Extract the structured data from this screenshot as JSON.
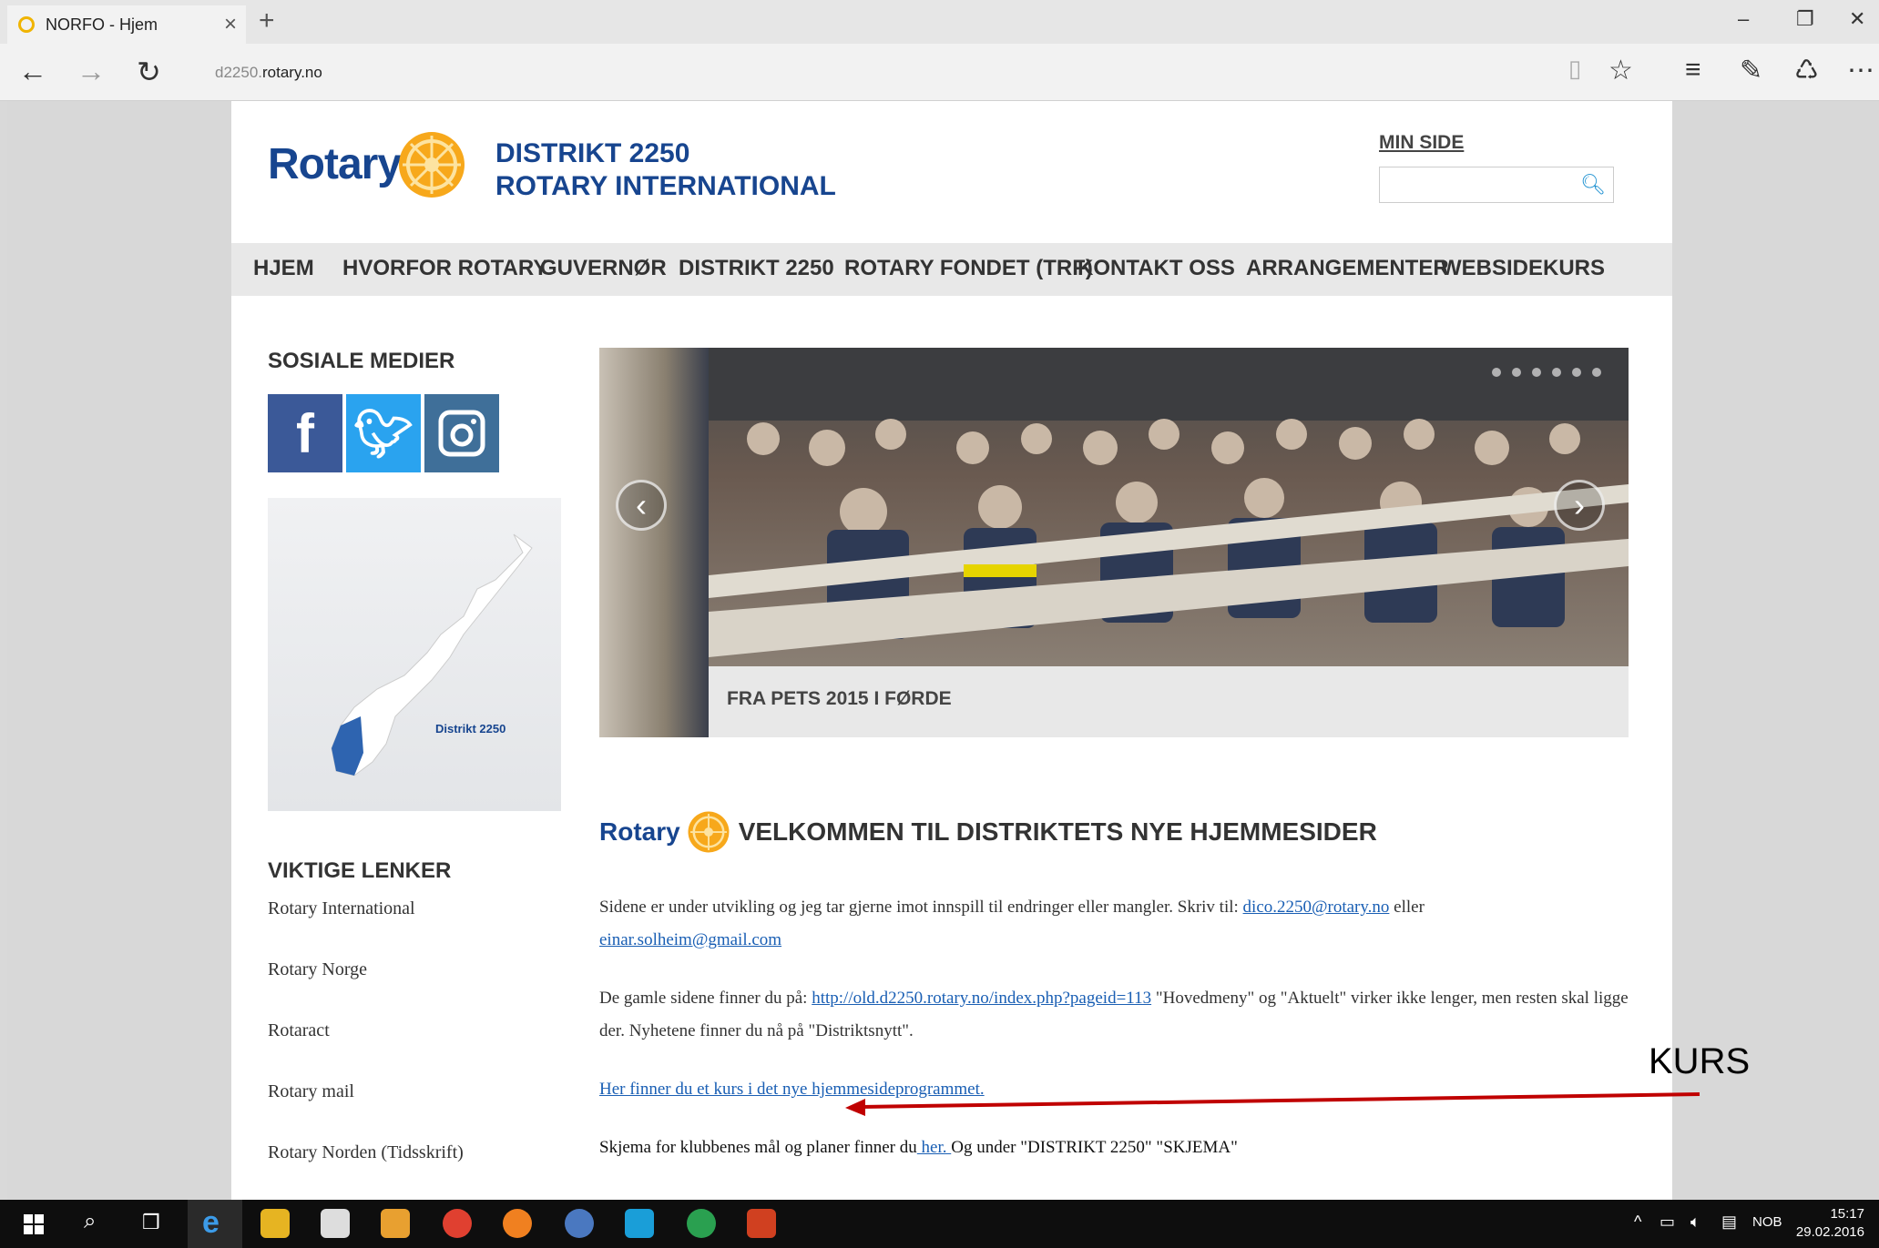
{
  "browser": {
    "tab_title": "NORFO - Hjem",
    "url_dim": "d2250.",
    "url_main": "rotary.no"
  },
  "header": {
    "logo_text": "Rotary",
    "district_line1": "DISTRIKT 2250",
    "district_line2": "ROTARY INTERNATIONAL",
    "min_side": "MIN SIDE",
    "search_value": ""
  },
  "menu": [
    "HJEM",
    "HVORFOR ROTARY",
    "GUVERNØR",
    "DISTRIKT 2250",
    "ROTARY FONDET (TRF)",
    "KONTAKT OSS",
    "ARRANGEMENTER",
    "WEBSIDEKURS"
  ],
  "sidebar": {
    "social_heading": "SOSIALE MEDIER",
    "map_label": "Distrikt 2250",
    "links_heading": "VIKTIGE LENKER",
    "links": [
      "Rotary International",
      "Rotary Norge",
      "Rotaract",
      "Rotary mail",
      "Rotary Norden (Tidsskrift)"
    ]
  },
  "slider": {
    "caption": "FRA PETS 2015 I FØRDE"
  },
  "main": {
    "logo_text": "Rotary",
    "welcome_title": "VELKOMMEN TIL DISTRIKTETS NYE HJEMMESIDER",
    "p1_text": "Sidene er under utvikling og jeg tar gjerne imot innspill til endringer eller mangler. Skriv til: ",
    "p1_link1": "dico.2250@rotary.no",
    "p1_mid": " eller",
    "p1_link2": "einar.solheim@gmail.com",
    "p2_text": "De gamle sidene finner du på: ",
    "p2_link": "http://old.d2250.rotary.no/index.php?pageid=113",
    "p2_rest": "  \"Hovedmeny\" og \"Aktuelt\" virker ikke lenger, men resten skal ligge der. Nyhetene finner du nå på \"Distriktsnytt\".",
    "p3_link": "Her finner du et kurs i det nye hjemmesideprogrammet.",
    "p4_text": "Skjema for klubbenes mål og planer finner du",
    "p4_link": " her. ",
    "p4_rest": "     Og under \"DISTRIKT 2250\" \"SKJEMA\""
  },
  "annotation": {
    "label": "KURS",
    "color": "#c00000"
  },
  "taskbar": {
    "lang": "NOB",
    "time": "15:17",
    "date": "29.02.2016"
  }
}
